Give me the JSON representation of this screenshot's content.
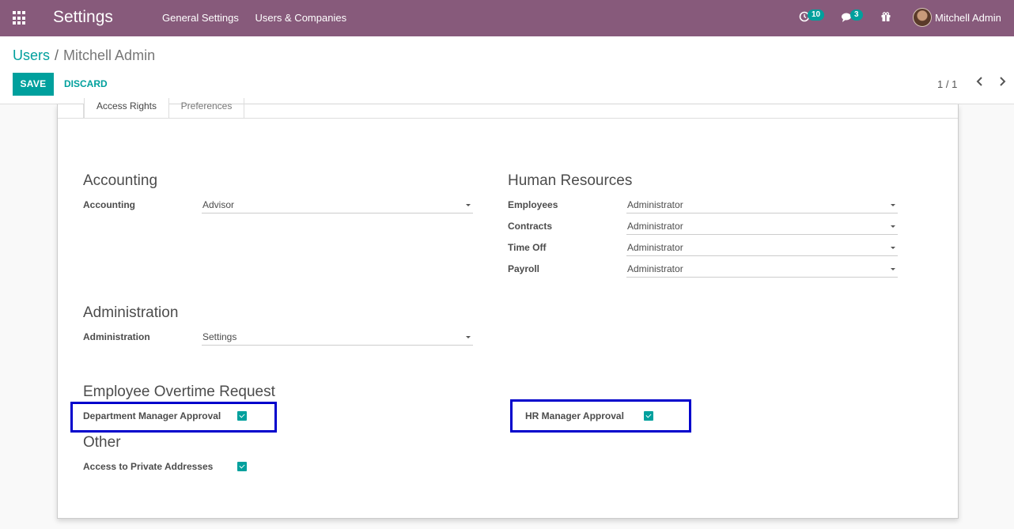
{
  "navbar": {
    "app_title": "Settings",
    "menu": [
      "General Settings",
      "Users & Companies"
    ],
    "activity_count": "10",
    "messages_count": "3",
    "user_name": "Mitchell Admin"
  },
  "breadcrumb": {
    "parent": "Users",
    "separator": "/",
    "current": "Mitchell Admin"
  },
  "buttons": {
    "save": "SAVE",
    "discard": "DISCARD"
  },
  "pager": {
    "value": "1 / 1"
  },
  "tabs": {
    "active": "Access Rights",
    "inactive": "Preferences"
  },
  "accounting": {
    "title": "Accounting",
    "fields": [
      {
        "label": "Accounting",
        "value": "Advisor"
      }
    ]
  },
  "hr": {
    "title": "Human Resources",
    "fields": [
      {
        "label": "Employees",
        "value": "Administrator"
      },
      {
        "label": "Contracts",
        "value": "Administrator"
      },
      {
        "label": "Time Off",
        "value": "Administrator"
      },
      {
        "label": "Payroll",
        "value": "Administrator"
      }
    ]
  },
  "administration": {
    "title": "Administration",
    "fields": [
      {
        "label": "Administration",
        "value": "Settings"
      }
    ]
  },
  "overtime": {
    "title": "Employee Overtime Request",
    "dept_manager_label": "Department Manager Approval",
    "dept_manager_checked": true,
    "hr_manager_label": "HR Manager Approval",
    "hr_manager_checked": true
  },
  "other": {
    "title": "Other",
    "private_addresses_label": "Access to Private Addresses",
    "private_addresses_checked": true
  },
  "colors": {
    "navbar": "#875a7b",
    "accent": "#00a09d",
    "highlight": "#0000cc"
  }
}
